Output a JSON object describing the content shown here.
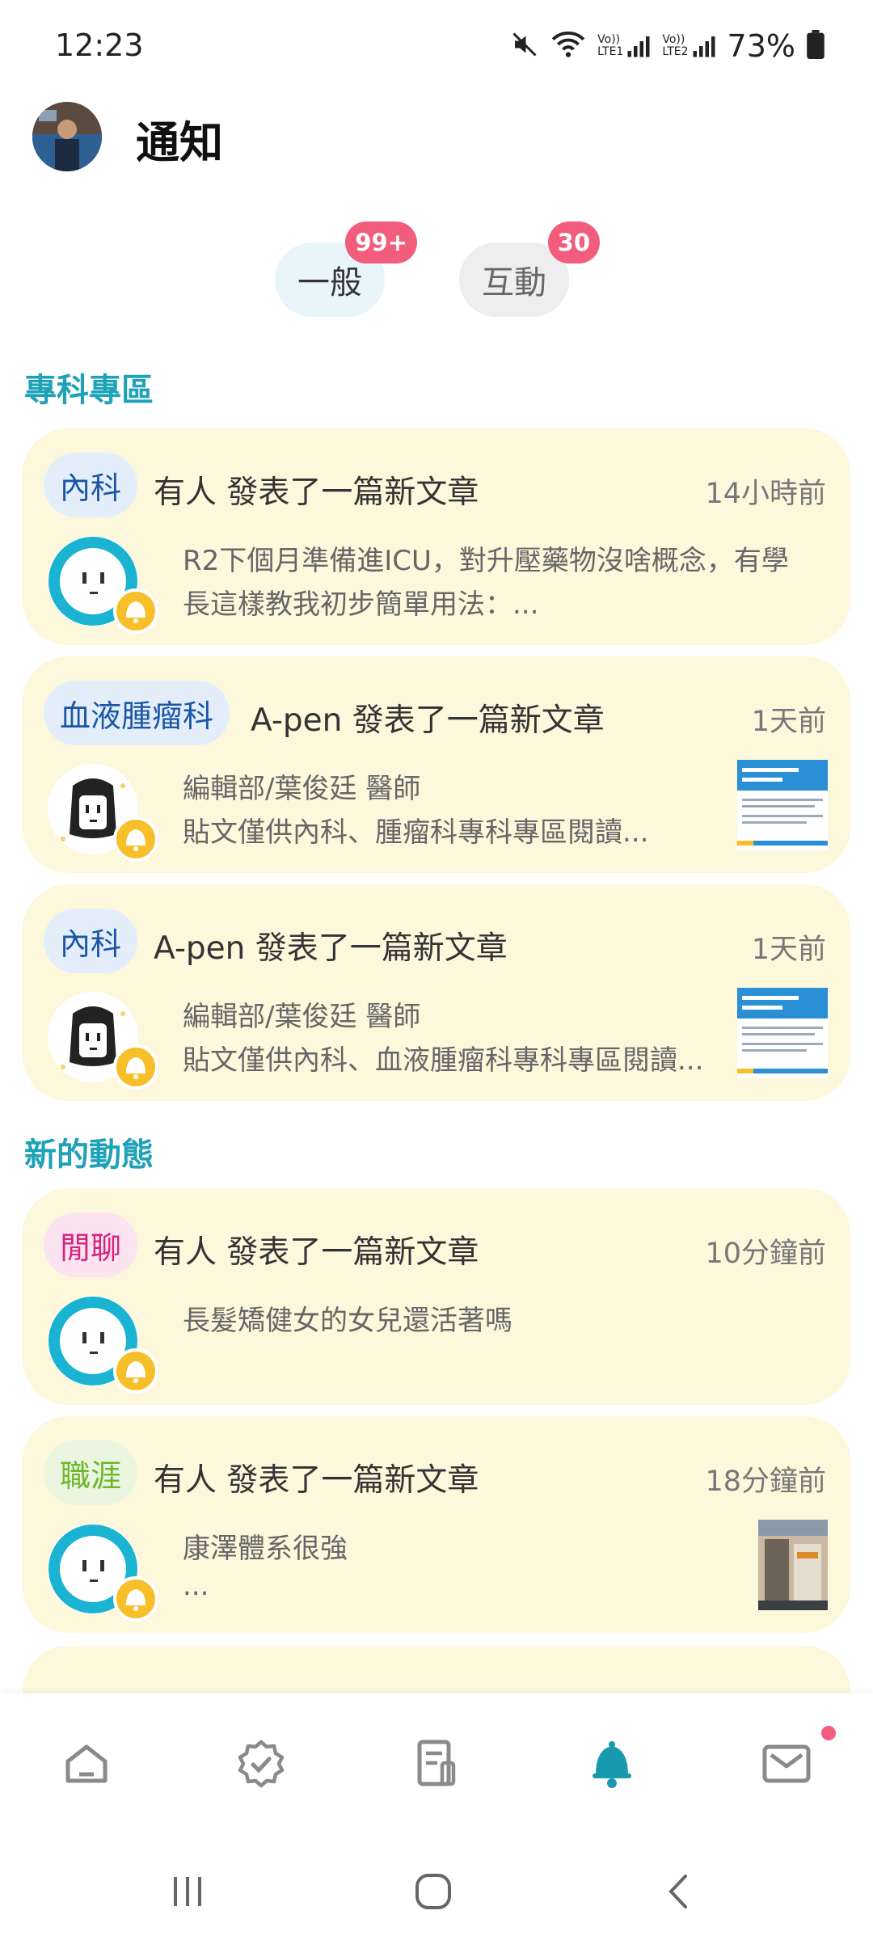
{
  "status_bar": {
    "time": "12:23",
    "battery_pct": "73%",
    "lte1": "LTE1",
    "lte2": "LTE2",
    "volte": "Vo))"
  },
  "header": {
    "title": "通知"
  },
  "tabs": [
    {
      "label": "一般",
      "badge": "99+",
      "selected": true
    },
    {
      "label": "互動",
      "badge": "30",
      "selected": false
    }
  ],
  "sections": {
    "specialty": {
      "title": "專科專區"
    },
    "news": {
      "title": "新的動態"
    }
  },
  "specialty_cards": [
    {
      "tag": "內科",
      "headline": "有人 發表了一篇新文章",
      "time": "14小時前",
      "body1": "R2下個月準備進ICU，對升壓藥物沒啥概念，有學",
      "body2": "長這樣教我初步簡單用法：..."
    },
    {
      "tag": "血液腫瘤科",
      "headline": "A-pen 發表了一篇新文章",
      "time": "1天前",
      "body1": "編輯部/葉俊廷 醫師",
      "body2": "貼文僅供內科、腫瘤科專科專區閱讀..."
    },
    {
      "tag": "內科",
      "headline": "A-pen 發表了一篇新文章",
      "time": "1天前",
      "body1": "編輯部/葉俊廷 醫師",
      "body2": "貼文僅供內科、血液腫瘤科專科專區閱讀..."
    }
  ],
  "news_cards": [
    {
      "tag": "閒聊",
      "headline": "有人 發表了一篇新文章",
      "time": "10分鐘前",
      "body1": "長髮矯健女的女兒還活著嗎",
      "body2": ""
    },
    {
      "tag": "職涯",
      "headline": "有人 發表了一篇新文章",
      "time": "18分鐘前",
      "body1": "康澤體系很強",
      "body2": "..."
    }
  ],
  "colors": {
    "accent": "#1fa2b8",
    "card_bg": "#fdf7dc",
    "badge": "#f25d7d",
    "bell": "#f7c02b"
  },
  "icons": {
    "nav": [
      "home-icon",
      "verified-badge-icon",
      "article-icon",
      "bell-icon",
      "mail-icon"
    ],
    "active_nav": "bell-icon"
  }
}
